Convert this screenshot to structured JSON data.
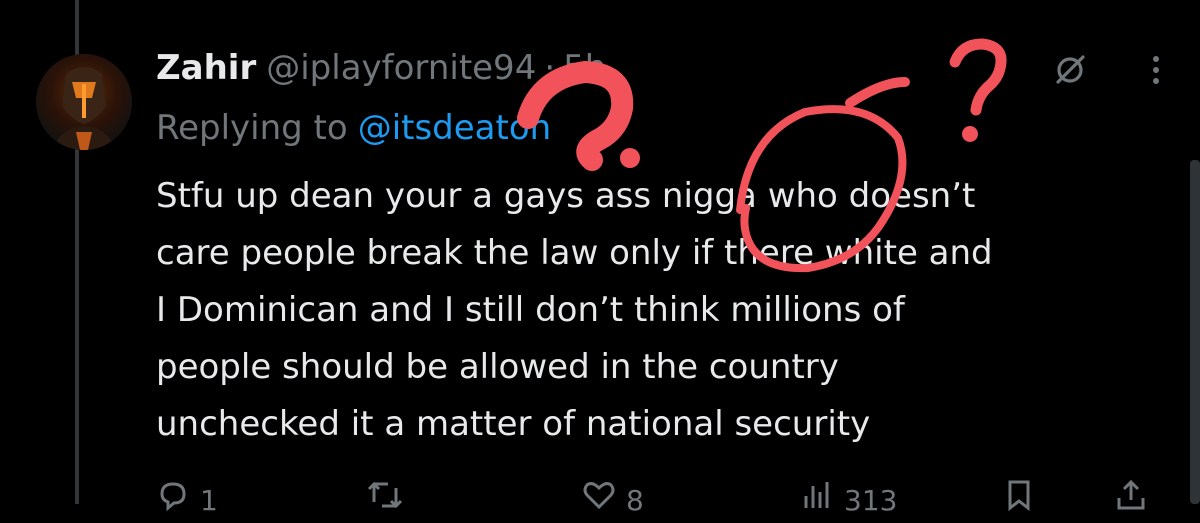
{
  "tweet": {
    "author_name": "Zahir",
    "author_handle": "@iplayfornite94",
    "separator": "·",
    "timestamp": "5h",
    "replying_prefix": "Replying to",
    "replying_to": "@itsdeaton",
    "text_lines": [
      "Stfu up dean your a gays ass nigga who doesn’t",
      "care people break the law only if there white and",
      "I Dominican and I still don’t think millions of",
      "people should be allowed in the country",
      "unchecked it a matter of national security"
    ]
  },
  "actions": {
    "reply_count": "1",
    "retweet_count": "",
    "like_count": "8",
    "views_count": "313"
  },
  "icons": {
    "grok": "grok-icon",
    "more": "more-icon",
    "reply": "reply-icon",
    "retweet": "retweet-icon",
    "like": "like-icon",
    "views": "views-icon",
    "share": "share-icon"
  },
  "colors": {
    "background": "#000000",
    "text": "#e7e9ea",
    "muted": "#71767b",
    "link": "#1d9bf0",
    "annotation": "#f2525a"
  }
}
